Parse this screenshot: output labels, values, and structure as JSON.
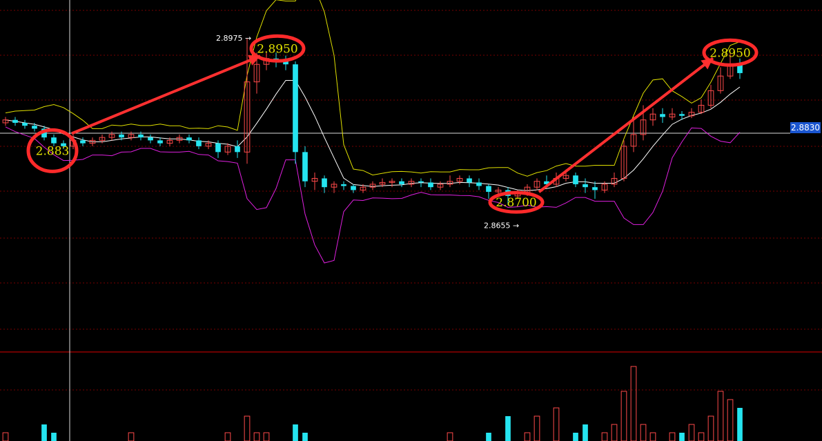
{
  "chart_data": {
    "type": "candlestick",
    "series": [
      {
        "name": "candles",
        "values": [
          [
            2.883,
            2.8835,
            2.884,
            2.8825
          ],
          [
            2.8835,
            2.883,
            2.884,
            2.8825
          ],
          [
            2.883,
            2.8825,
            2.8835,
            2.882
          ],
          [
            2.8825,
            2.882,
            2.883,
            2.8815
          ],
          [
            2.882,
            2.8805,
            2.8825,
            2.88
          ],
          [
            2.8805,
            2.8795,
            2.881,
            2.879
          ],
          [
            2.8795,
            2.879,
            2.88,
            2.8785
          ],
          [
            2.879,
            2.88,
            2.881,
            2.8785
          ],
          [
            2.88,
            2.8795,
            2.8805,
            2.879
          ],
          [
            2.8795,
            2.88,
            2.8805,
            2.879
          ],
          [
            2.88,
            2.8805,
            2.881,
            2.8795
          ],
          [
            2.8805,
            2.881,
            2.8815,
            2.88
          ],
          [
            2.881,
            2.8805,
            2.8815,
            2.88
          ],
          [
            2.8805,
            2.881,
            2.8815,
            2.88
          ],
          [
            2.881,
            2.8805,
            2.8815,
            2.88
          ],
          [
            2.8805,
            2.88,
            2.881,
            2.8795
          ],
          [
            2.88,
            2.8795,
            2.8805,
            2.879
          ],
          [
            2.8795,
            2.88,
            2.8805,
            2.879
          ],
          [
            2.88,
            2.8805,
            2.881,
            2.8795
          ],
          [
            2.8805,
            2.88,
            2.881,
            2.8795
          ],
          [
            2.88,
            2.879,
            2.8805,
            2.8785
          ],
          [
            2.879,
            2.8795,
            2.88,
            2.8785
          ],
          [
            2.8795,
            2.878,
            2.88,
            2.877
          ],
          [
            2.878,
            2.879,
            2.8795,
            2.8775
          ],
          [
            2.879,
            2.878,
            2.88,
            2.877
          ],
          [
            2.878,
            2.89,
            2.8975,
            2.876
          ],
          [
            2.89,
            2.893,
            2.895,
            2.888
          ],
          [
            2.893,
            2.894,
            2.895,
            2.892
          ],
          [
            2.894,
            2.8935,
            2.895,
            2.8925
          ],
          [
            2.8935,
            2.893,
            2.8945,
            2.892
          ],
          [
            2.893,
            2.878,
            2.8935,
            2.876
          ],
          [
            2.878,
            2.873,
            2.879,
            2.872
          ],
          [
            2.873,
            2.8735,
            2.8745,
            2.8715
          ],
          [
            2.8735,
            2.872,
            2.874,
            2.871
          ],
          [
            2.872,
            2.8725,
            2.873,
            2.871
          ],
          [
            2.8725,
            2.8722,
            2.873,
            2.8715
          ],
          [
            2.8722,
            2.8715,
            2.8725,
            2.871
          ],
          [
            2.8715,
            2.872,
            2.8725,
            2.871
          ],
          [
            2.872,
            2.8725,
            2.873,
            2.8715
          ],
          [
            2.8725,
            2.8728,
            2.8735,
            2.872
          ],
          [
            2.8728,
            2.873,
            2.8735,
            2.872
          ],
          [
            2.873,
            2.8725,
            2.8735,
            2.872
          ],
          [
            2.8725,
            2.873,
            2.8735,
            2.872
          ],
          [
            2.873,
            2.8728,
            2.8735,
            2.872
          ],
          [
            2.8728,
            2.872,
            2.8735,
            2.8715
          ],
          [
            2.872,
            2.8725,
            2.873,
            2.8715
          ],
          [
            2.8725,
            2.873,
            2.874,
            2.872
          ],
          [
            2.873,
            2.8735,
            2.874,
            2.8725
          ],
          [
            2.8735,
            2.8728,
            2.874,
            2.872
          ],
          [
            2.8728,
            2.8722,
            2.8735,
            2.8715
          ],
          [
            2.8722,
            2.8712,
            2.8725,
            2.87
          ],
          [
            2.8712,
            2.8715,
            2.872,
            2.8705
          ],
          [
            2.8715,
            2.8705,
            2.872,
            2.869
          ],
          [
            2.8705,
            2.871,
            2.8715,
            2.87
          ],
          [
            2.871,
            2.872,
            2.8725,
            2.8705
          ],
          [
            2.872,
            2.873,
            2.8735,
            2.8715
          ],
          [
            2.873,
            2.8725,
            2.874,
            2.872
          ],
          [
            2.8725,
            2.8735,
            2.8745,
            2.872
          ],
          [
            2.8735,
            2.874,
            2.875,
            2.873
          ],
          [
            2.874,
            2.8725,
            2.8745,
            2.872
          ],
          [
            2.8725,
            2.872,
            2.8735,
            2.871
          ],
          [
            2.872,
            2.8715,
            2.873,
            2.87
          ],
          [
            2.8715,
            2.8725,
            2.873,
            2.871
          ],
          [
            2.8725,
            2.8735,
            2.8745,
            2.872
          ],
          [
            2.8735,
            2.879,
            2.88,
            2.873
          ],
          [
            2.879,
            2.881,
            2.884,
            2.878
          ],
          [
            2.881,
            2.8835,
            2.886,
            2.88
          ],
          [
            2.8835,
            2.8845,
            2.8855,
            2.8825
          ],
          [
            2.8845,
            2.884,
            2.8855,
            2.883
          ],
          [
            2.884,
            2.8845,
            2.8855,
            2.8835
          ],
          [
            2.8845,
            2.8842,
            2.885,
            2.8835
          ],
          [
            2.8842,
            2.8848,
            2.8855,
            2.8838
          ],
          [
            2.8848,
            2.886,
            2.887,
            2.8845
          ],
          [
            2.886,
            2.8885,
            2.8895,
            2.8855
          ],
          [
            2.8885,
            2.891,
            2.8925,
            2.888
          ],
          [
            2.891,
            2.893,
            2.895,
            2.8905
          ],
          [
            2.893,
            2.8915,
            2.894,
            2.8905
          ]
        ]
      }
    ],
    "bands": {
      "upper_max": 2.904,
      "mid_ma": true,
      "lower_min": 2.845
    },
    "price_current": "2.8830",
    "annotations": [
      {
        "label": "2.883",
        "target_index": 4,
        "price": 2.88
      },
      {
        "label": "2.8950",
        "target_index": 26,
        "price": 2.895
      },
      {
        "label": "2.8700",
        "target_index": 52,
        "price": 2.87
      },
      {
        "label": "2.8950",
        "target_index": 75,
        "price": 2.895
      }
    ],
    "extremes": [
      {
        "label": "2.8975",
        "type": "high"
      },
      {
        "label": "2.8655",
        "type": "low"
      }
    ],
    "grid": true,
    "volume": [
      1,
      0,
      0,
      0,
      2,
      1,
      0,
      0,
      0,
      0,
      0,
      0,
      0,
      1,
      0,
      0,
      0,
      0,
      0,
      0,
      0,
      0,
      0,
      1,
      0,
      3,
      1,
      1,
      0,
      0,
      2,
      1,
      0,
      0,
      0,
      0,
      0,
      0,
      0,
      0,
      0,
      0,
      0,
      0,
      0,
      0,
      1,
      0,
      0,
      0,
      1,
      0,
      3,
      0,
      1,
      3,
      0,
      4,
      0,
      1,
      2,
      0,
      1,
      2,
      6,
      9,
      2,
      1,
      0,
      1,
      1,
      2,
      1,
      3,
      6,
      5,
      4
    ]
  },
  "price_axis_label": "2.8830",
  "colors": {
    "up": "#ff4a4a",
    "down": "#25e4f0",
    "upper": "#e0e000",
    "lower": "#e020e0",
    "mid": "#ffffff",
    "grid": "#7a0000"
  }
}
